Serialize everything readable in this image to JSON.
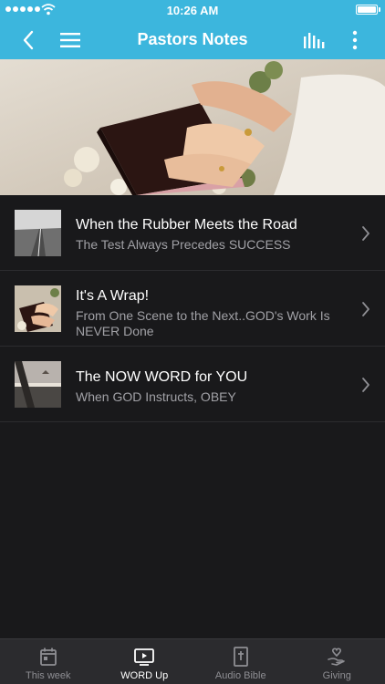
{
  "status_bar": {
    "time": "10:26 AM"
  },
  "nav": {
    "title": "Pastors Notes",
    "back_icon": "chevron-left-icon",
    "menu_icon": "hamburger-menu-icon",
    "audio_icon": "equalizer-bars-icon",
    "more_icon": "more-vertical-icon"
  },
  "items": [
    {
      "title": "When the Rubber Meets the Road",
      "subtitle": "The Test Always Precedes SUCCESS"
    },
    {
      "title": "It's A Wrap!",
      "subtitle": "From One Scene to the Next..GOD's Work Is NEVER Done"
    },
    {
      "title": "The NOW WORD for YOU",
      "subtitle": "When GOD Instructs, OBEY"
    }
  ],
  "tabs": [
    {
      "label": "This week",
      "icon": "calendar-icon",
      "active": false
    },
    {
      "label": "WORD Up",
      "icon": "video-play-icon",
      "active": true
    },
    {
      "label": "Audio Bible",
      "icon": "bible-icon",
      "active": false
    },
    {
      "label": "Giving",
      "icon": "hand-heart-icon",
      "active": false
    }
  ],
  "colors": {
    "accent": "#3cb6dd",
    "background": "#19191b",
    "tab_bar": "#2b2b2e"
  }
}
